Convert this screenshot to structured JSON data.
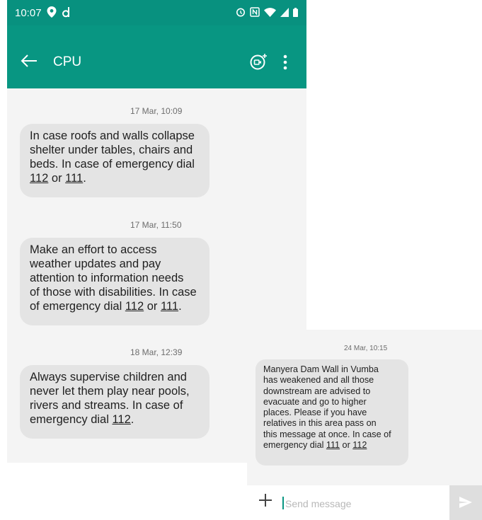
{
  "status_bar": {
    "time": "10:07",
    "icons_left": [
      "location-pin-icon",
      "d-app-icon"
    ],
    "icons_right": [
      "alarm-icon",
      "nfc-icon",
      "wifi-icon",
      "signal-icon",
      "battery-icon"
    ]
  },
  "app_bar": {
    "title": "CPU",
    "icons": [
      "back-arrow-icon",
      "video-call-add-icon",
      "more-vert-icon"
    ]
  },
  "messages": [
    {
      "timestamp": "17 Mar, 10:09",
      "lines": [
        "In case roofs and walls collapse",
        "shelter under tables, chairs and",
        "beds. In case of emergency dial"
      ],
      "tail": {
        "n1": "112",
        "sep": " or ",
        "n2": "111",
        "end": "."
      }
    },
    {
      "timestamp": "17 Mar, 11:50",
      "lines": [
        "Make an effort to access",
        "weather updates and pay",
        "attention to information needs",
        "of those with disabilities. In case"
      ],
      "tail": {
        "pre": "of emergency dial ",
        "n1": "112",
        "sep": " or ",
        "n2": "111",
        "end": "."
      }
    },
    {
      "timestamp": "18 Mar, 12:39",
      "lines": [
        "Always supervise children and",
        "never let them play near pools,",
        "rivers and streams. In case of"
      ],
      "tail": {
        "pre": "emergency dial ",
        "n1": "112",
        "end": "."
      }
    }
  ],
  "second_screen": {
    "timestamp": "24 Mar, 10:15",
    "lines": [
      "Manyera Dam Wall in Vumba",
      "has weakened and all those",
      "downstream are advised to",
      "evacuate and go to higher",
      "places. Please if you have",
      "relatives in this area pass on",
      "this message at once. In case of"
    ],
    "tail": {
      "pre": "emergency dial ",
      "n1": "111",
      "sep": " or ",
      "n2": "112"
    },
    "composer": {
      "placeholder": "Send message",
      "icons": [
        "add-plus-icon",
        "send-icon"
      ]
    }
  },
  "colors": {
    "accent": "#089682",
    "bubble": "#e4e4e4",
    "background": "#f4f4f4"
  }
}
